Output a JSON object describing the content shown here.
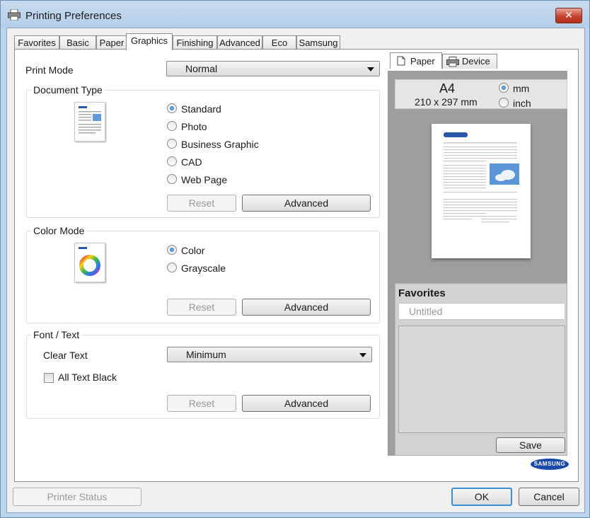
{
  "window": {
    "title": "Printing Preferences",
    "close_label": "✕"
  },
  "tabs": [
    "Favorites",
    "Basic",
    "Paper",
    "Graphics",
    "Finishing",
    "Advanced",
    "Eco",
    "Samsung"
  ],
  "print_mode": {
    "label": "Print Mode",
    "value": "Normal"
  },
  "document_type": {
    "title": "Document Type",
    "options": [
      "Standard",
      "Photo",
      "Business Graphic",
      "CAD",
      "Web Page"
    ],
    "selected": "Standard",
    "reset_label": "Reset",
    "advanced_label": "Advanced"
  },
  "color_mode": {
    "title": "Color Mode",
    "options": [
      "Color",
      "Grayscale"
    ],
    "selected": "Color",
    "reset_label": "Reset",
    "advanced_label": "Advanced"
  },
  "font_text": {
    "title": "Font / Text",
    "clear_text_label": "Clear Text",
    "clear_text_value": "Minimum",
    "all_text_black_label": "All Text Black",
    "all_text_black_checked": false,
    "reset_label": "Reset",
    "advanced_label": "Advanced"
  },
  "preview": {
    "tabs": [
      "Paper",
      "Device"
    ],
    "paper_size": "A4",
    "paper_dims": "210 x 297 mm",
    "units": [
      "mm",
      "inch"
    ],
    "unit_selected": "mm"
  },
  "favorites": {
    "title": "Favorites",
    "name_placeholder": "Untitled",
    "save_label": "Save"
  },
  "brand": {
    "logo_text": "SAMSUNG",
    "color": "#1a4aa8"
  },
  "footer": {
    "printer_status_label": "Printer Status",
    "ok_label": "OK",
    "cancel_label": "Cancel"
  }
}
